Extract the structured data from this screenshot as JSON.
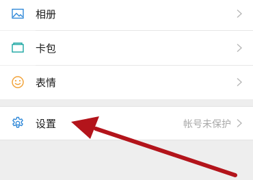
{
  "menu": {
    "items": [
      {
        "label": "相册",
        "icon": "photo-icon"
      },
      {
        "label": "卡包",
        "icon": "card-icon"
      },
      {
        "label": "表情",
        "icon": "emoji-icon"
      }
    ],
    "settings": {
      "label": "设置",
      "icon": "gear-icon",
      "status": "帐号未保护"
    }
  },
  "colors": {
    "accent_blue": "#2f88d8",
    "card_teal": "#18a6a1",
    "emoji_orange": "#f2a33a",
    "arrow_red": "#b3141b",
    "background": "#eeeeee"
  }
}
